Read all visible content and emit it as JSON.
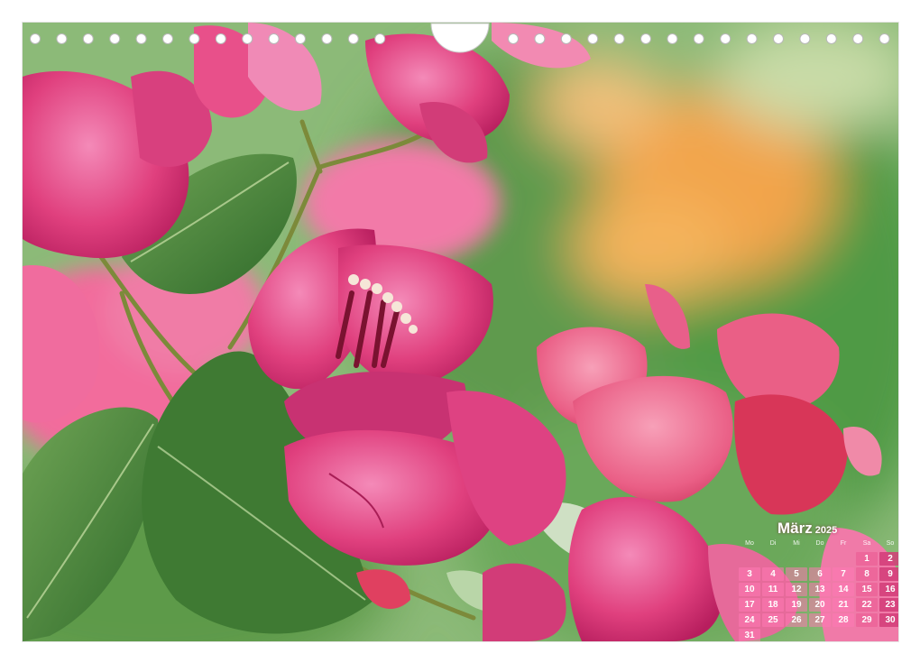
{
  "photo": {
    "subject": "pink bougainvillea blossoms with green leaves, blurred orange flowers in background",
    "colors": {
      "petal": "#e0407e",
      "petal_light": "#f07aa8",
      "leaf": "#4f8a3a",
      "background": "#7fb06a",
      "accent_orange": "#f2a44c"
    }
  },
  "calendar": {
    "month": "März",
    "year": "2025",
    "weekdays": [
      "Mo",
      "Di",
      "Mi",
      "Do",
      "Fr",
      "Sa",
      "So"
    ],
    "leading_blanks": 5,
    "days": [
      "1",
      "2",
      "3",
      "4",
      "5",
      "6",
      "7",
      "8",
      "9",
      "10",
      "11",
      "12",
      "13",
      "14",
      "15",
      "16",
      "17",
      "18",
      "19",
      "20",
      "21",
      "22",
      "23",
      "24",
      "25",
      "26",
      "27",
      "28",
      "29",
      "30",
      "31"
    ],
    "colors": {
      "weekday_cell": "#f58ab8",
      "saturday_cell": "#eb5f96",
      "sunday_cell": "#d23c78",
      "text": "#ffffff"
    }
  }
}
